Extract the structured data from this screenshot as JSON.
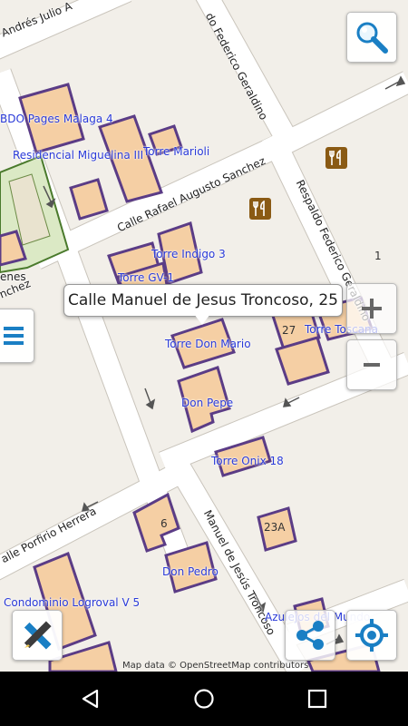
{
  "streets": {
    "andres": "Andrés Julio A",
    "federico_top": "do Federico Geraldino",
    "rafael": "Calle Rafael Augusto Sanchez",
    "respaldo": "Respaldo Federico Geraldino",
    "porfirio": "alle Porfirio Herrera",
    "manuel": "Manuel de Jesús Troncoso",
    "nches": "nchez",
    "enes": "enes"
  },
  "places": {
    "bdo": "BDO Pages Malaga 4",
    "miguelina": "Residencial Miguelina III",
    "marioli": "Torre Marioli",
    "indigo": "Torre Indigo 3",
    "gv1": "Torre GV-1",
    "don_mario": "Torre Don Mario",
    "toscana": "Torre Toscana",
    "don_pepe": "Don Pepe",
    "onix": "Torre Onix 18",
    "don_pedro": "Don Pedro",
    "logroval": "Condominio Logroval V 5",
    "azulejos": "Azulejos del Mundo"
  },
  "numbers": {
    "n27": "27",
    "n6": "6",
    "n23a": "23A",
    "n1": "1"
  },
  "tooltip": "Calle Manuel de Jesus Troncoso, 25",
  "attribution": "Map data © OpenStreetMap contributors",
  "colors": {
    "building_fill": "#f5cfa4",
    "building_stroke": "#5b3c86",
    "road": "#ffffff",
    "land": "#f2efe9",
    "poi": "#8a5a14",
    "accent": "#1a7fc4"
  },
  "icons": {
    "search": "search-icon",
    "zoom_in": "plus-icon",
    "zoom_out": "minus-icon",
    "menu": "list-icon",
    "tools": "ruler-pencil-icon",
    "share": "share-icon",
    "locate": "locate-icon",
    "back": "back-icon",
    "home": "home-icon",
    "recents": "recents-icon"
  }
}
